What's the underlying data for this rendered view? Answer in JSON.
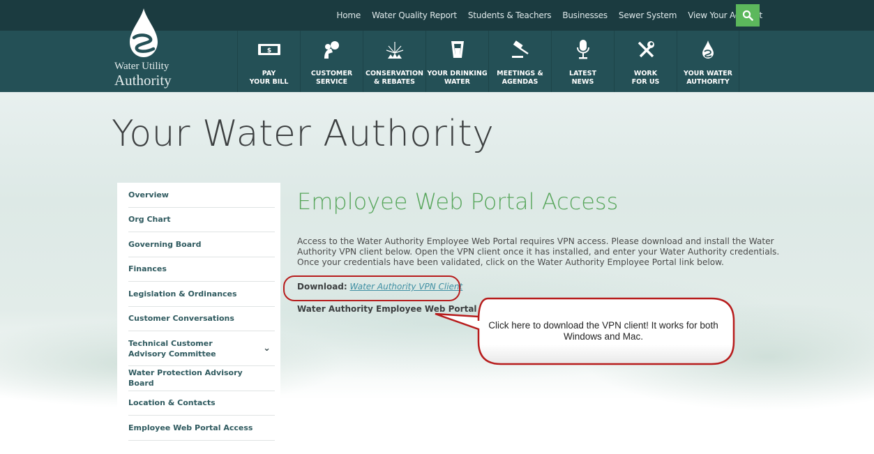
{
  "top_nav": [
    "Home",
    "Water Quality Report",
    "Students & Teachers",
    "Businesses",
    "Sewer System",
    "View Your Account"
  ],
  "logo": {
    "line1": "Water Utility",
    "line2": "Authority"
  },
  "main_nav": [
    {
      "label": "PAY\nYOUR BILL",
      "icon": "money-icon"
    },
    {
      "label": "CUSTOMER\nSERVICE",
      "icon": "customer-service-icon"
    },
    {
      "label": "CONSERVATION\n& REBATES",
      "icon": "sprinkler-icon"
    },
    {
      "label": "YOUR DRINKING\nWATER",
      "icon": "water-glass-icon"
    },
    {
      "label": "MEETINGS &\nAGENDAS",
      "icon": "gavel-icon"
    },
    {
      "label": "LATEST\nNEWS",
      "icon": "microphone-icon"
    },
    {
      "label": "WORK\nFOR US",
      "icon": "tools-icon"
    },
    {
      "label": "YOUR WATER\nAUTHORITY",
      "icon": "water-drop-icon"
    }
  ],
  "hero": {
    "title": "Your Water Authority"
  },
  "sidebar": {
    "items": [
      {
        "label": "Overview"
      },
      {
        "label": "Org Chart"
      },
      {
        "label": "Governing Board"
      },
      {
        "label": "Finances"
      },
      {
        "label": "Legislation & Ordinances"
      },
      {
        "label": "Customer Conversations"
      },
      {
        "label": "Technical Customer Advisory Committee",
        "expandable": true
      },
      {
        "label": "Water Protection Advisory Board"
      },
      {
        "label": "Location & Contacts"
      },
      {
        "label": "Employee Web Portal Access"
      }
    ]
  },
  "main": {
    "title": "Employee Web Portal Access",
    "paragraph": "Access to the Water Authority Employee Web Portal requires VPN access. Please download and install the Water Authority VPN client below. Open the VPN client once it has installed, and enter your Water Authority credentials. Once your credentials have been validated, click on the Water Authority Employee Portal link below.",
    "download_label": "Download:",
    "download_link": "Water Authority VPN Client",
    "portal_link_text": "Water Authority Employee Web Portal Lin"
  },
  "callout": {
    "text": "Click here to download the VPN client! It works for both Windows and Mac."
  },
  "colors": {
    "header_top": "#1b3b40",
    "header_main": "#245056",
    "search": "#5cb85c",
    "accent_green": "#58a65c",
    "annotation_red": "#b71c1c"
  }
}
